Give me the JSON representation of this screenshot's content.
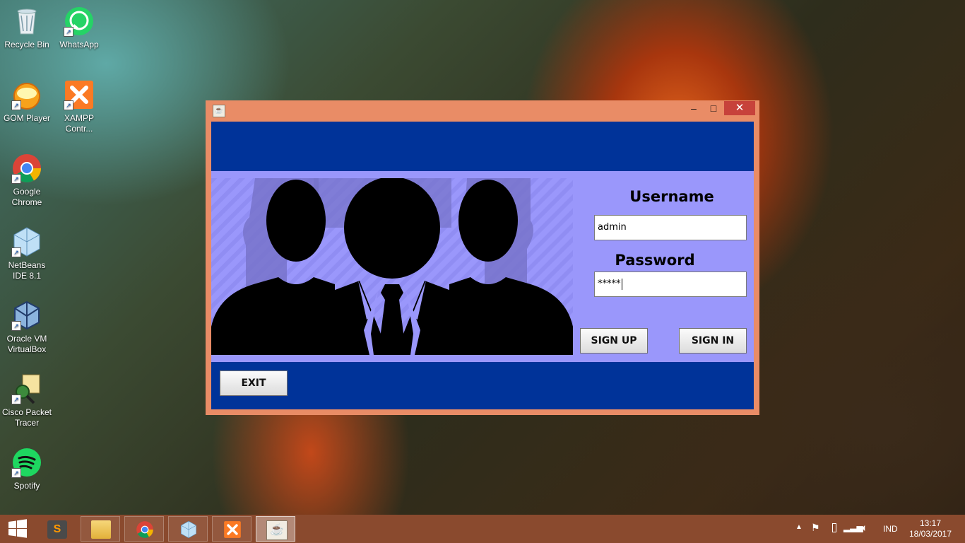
{
  "desktop_icons": [
    {
      "label": "Recycle Bin",
      "icon": "recycle-bin-icon"
    },
    {
      "label": "WhatsApp",
      "icon": "whatsapp-icon"
    },
    {
      "label": "GOM Player",
      "icon": "gom-player-icon"
    },
    {
      "label": "XAMPP Contr...",
      "icon": "xampp-icon"
    },
    {
      "label": "Google Chrome",
      "icon": "chrome-icon"
    },
    {
      "label": "NetBeans IDE 8.1",
      "icon": "netbeans-icon"
    },
    {
      "label": "Oracle VM VirtualBox",
      "icon": "virtualbox-icon"
    },
    {
      "label": "Cisco Packet Tracer",
      "icon": "packet-tracer-icon"
    },
    {
      "label": "Spotify",
      "icon": "spotify-icon"
    }
  ],
  "window": {
    "icon": "java-icon",
    "minimize_glyph": "–",
    "maximize_glyph": "□",
    "close_glyph": "✕"
  },
  "login": {
    "username_label": "Username",
    "username_value": "admin",
    "password_label": "Password",
    "password_value": "*****",
    "signup_label": "SIGN UP",
    "signin_label": "SIGN IN",
    "exit_label": "EXIT"
  },
  "colors": {
    "header_blue": "#003399",
    "panel_lavender": "#9a97fb",
    "window_frame": "#e98c66",
    "close_red": "#c7423b"
  },
  "taskbar": {
    "items": [
      {
        "name": "sublime-text",
        "icon": "sublime-icon"
      },
      {
        "name": "file-explorer",
        "icon": "folder-icon"
      },
      {
        "name": "google-chrome",
        "icon": "chrome-icon"
      },
      {
        "name": "netbeans",
        "icon": "netbeans-icon"
      },
      {
        "name": "xampp",
        "icon": "xampp-icon"
      },
      {
        "name": "java-app",
        "icon": "java-icon"
      }
    ],
    "language": "IND",
    "time": "13:17",
    "date": "18/03/2017"
  }
}
